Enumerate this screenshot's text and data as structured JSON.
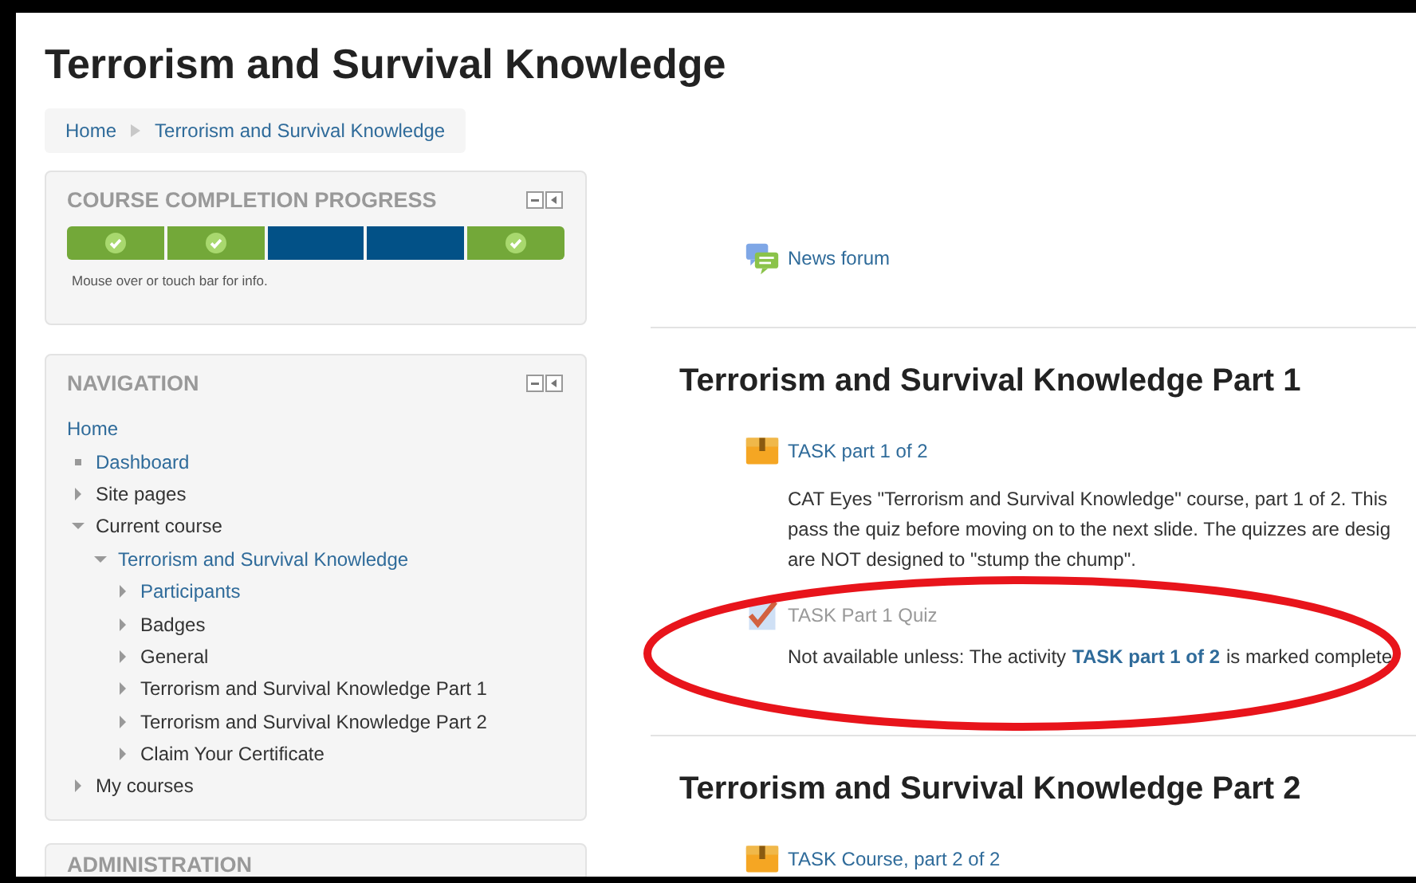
{
  "page_title": "Terrorism and Survival Knowledge",
  "breadcrumb": [
    "Home",
    "Terrorism and Survival Knowledge"
  ],
  "completion_block": {
    "title": "COURSE COMPLETION PROGRESS",
    "segments": [
      {
        "completed": true
      },
      {
        "completed": true
      },
      {
        "completed": false
      },
      {
        "completed": false
      },
      {
        "completed": true
      }
    ],
    "hint": "Mouse over or touch bar for info."
  },
  "navigation": {
    "title": "NAVIGATION",
    "items": [
      {
        "label": "Home",
        "kind": "root",
        "link": true,
        "children": [
          {
            "label": "Dashboard",
            "kind": "leaf",
            "link": true
          },
          {
            "label": "Site pages",
            "kind": "branch",
            "expanded": false,
            "link": false
          },
          {
            "label": "Current course",
            "kind": "branch",
            "expanded": true,
            "link": false,
            "children": [
              {
                "label": "Terrorism and Survival Knowledge",
                "kind": "branch",
                "expanded": true,
                "link": true,
                "children": [
                  {
                    "label": "Participants",
                    "kind": "branch",
                    "expanded": false,
                    "link": true
                  },
                  {
                    "label": "Badges",
                    "kind": "branch",
                    "expanded": false,
                    "link": false
                  },
                  {
                    "label": "General",
                    "kind": "branch",
                    "expanded": false,
                    "link": false
                  },
                  {
                    "label": "Terrorism and Survival Knowledge Part 1",
                    "kind": "branch",
                    "expanded": false,
                    "link": false
                  },
                  {
                    "label": "Terrorism and Survival Knowledge Part 2",
                    "kind": "branch",
                    "expanded": false,
                    "link": false
                  },
                  {
                    "label": "Claim Your Certificate",
                    "kind": "branch",
                    "expanded": false,
                    "link": false
                  }
                ]
              }
            ]
          },
          {
            "label": "My courses",
            "kind": "branch",
            "expanded": false,
            "link": false
          }
        ]
      }
    ]
  },
  "administration_block": {
    "title": "ADMINISTRATION"
  },
  "sections": [
    {
      "activities": [
        {
          "kind": "forum",
          "title": "News forum",
          "available": true
        }
      ]
    },
    {
      "title": "Terrorism and Survival Knowledge Part 1",
      "activities": [
        {
          "kind": "assignment",
          "title": "TASK part 1 of 2",
          "available": true,
          "description_lines": [
            "CAT Eyes \"Terrorism and Survival Knowledge\" course, part 1 of 2.  This",
            "pass the quiz before moving on to the next slide.  The quizzes are desig",
            "are NOT designed to \"stump the chump\"."
          ]
        },
        {
          "kind": "quiz",
          "title": "TASK Part 1 Quiz",
          "available": false,
          "restriction": {
            "prefix": "Not available unless: The activity",
            "link": "TASK part 1 of 2",
            "suffix": "is marked complete"
          }
        }
      ]
    },
    {
      "title": "Terrorism and Survival Knowledge Part 2",
      "activities": [
        {
          "kind": "assignment",
          "title": "TASK Course, part 2 of 2",
          "available": true
        }
      ]
    }
  ]
}
